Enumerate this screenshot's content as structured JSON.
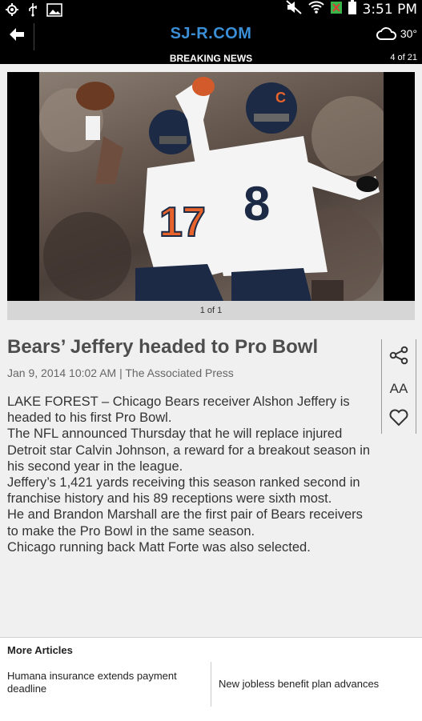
{
  "status_bar": {
    "time": "3:51 PM",
    "icons": [
      "location-icon",
      "usb-icon",
      "image-icon",
      "mute-icon",
      "wifi-icon",
      "signal-icon",
      "battery-icon"
    ]
  },
  "header": {
    "logo": "SJ-R.COM",
    "section": "BREAKING NEWS",
    "page_count": "4 of 21",
    "temperature": "30°",
    "weather_icon": "cloud-icon",
    "accent_color": "#3a8fd6"
  },
  "photo": {
    "caption": "1 of 1",
    "jersey_left": "17",
    "jersey_right": "8"
  },
  "article": {
    "headline": "Bears’ Jeffery headed to Pro Bowl",
    "byline": "Jan 9, 2014 10:02 AM | The Associated Press",
    "paragraphs": [
      "LAKE FOREST – Chicago Bears receiver Alshon Jeffery is headed to his first Pro Bowl.",
      "The NFL announced Thursday that he will replace injured Detroit star Calvin Johnson, a reward for a breakout season in his second year in the league.",
      "Jeffery’s 1,421 yards receiving this season ranked second in franchise history and his 89 receptions were sixth most.",
      "He and Brandon Marshall are the first pair of Bears receivers to make the Pro Bowl in the same season.",
      "Chicago running back Matt Forte was also selected."
    ]
  },
  "tools": {
    "font_label": "AA",
    "icons": [
      "share-icon",
      "font-size-icon",
      "heart-icon"
    ]
  },
  "more_articles": {
    "title": "More Articles",
    "items": [
      "Humana insurance extends payment deadline",
      "New jobless benefit plan advances"
    ]
  }
}
